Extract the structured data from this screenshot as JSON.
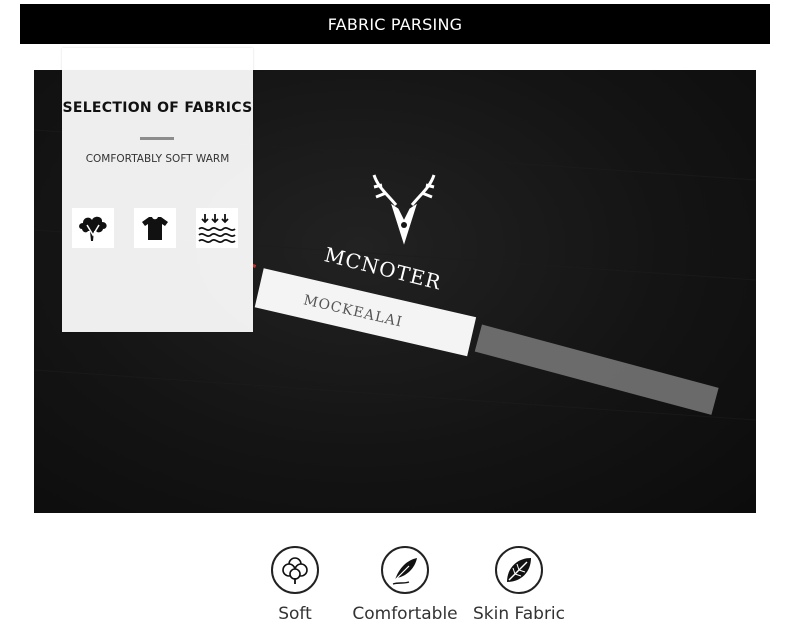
{
  "header": {
    "title": "FABRIC PARSING"
  },
  "card": {
    "title": "SELECTION OF FABRICS",
    "subtitle": "COMFORTABLY SOFT WARM",
    "icons": [
      "cloud-tree-icon",
      "tshirt-icon",
      "water-wave-icon"
    ]
  },
  "photo": {
    "brand": "MCNOTER",
    "label": "MOCKEALAI",
    "logo": "deer-head-logo"
  },
  "features": [
    {
      "label": "Soft",
      "icon": "cotton-flower-icon"
    },
    {
      "label": "Comfortable",
      "icon": "feather-icon"
    },
    {
      "label": "Skin Fabric",
      "icon": "leaf-icon"
    }
  ],
  "colors": {
    "header_bg": "#000000",
    "photo_bg": "#161616",
    "card_bg": "#ffffff"
  }
}
